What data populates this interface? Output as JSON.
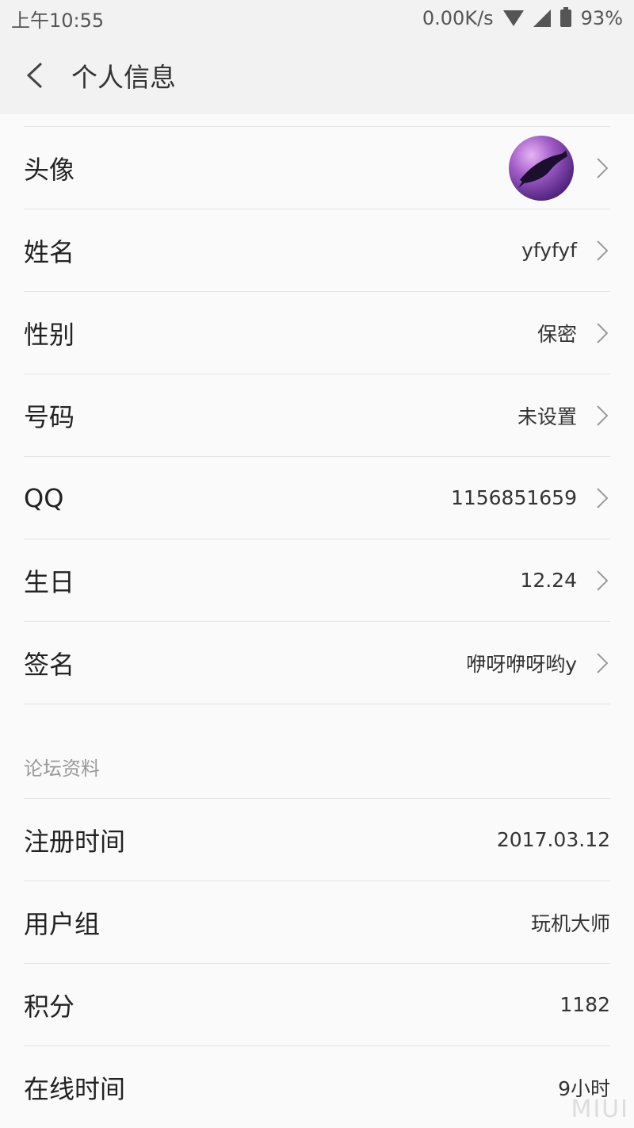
{
  "status_bar": {
    "time": "上午10:55",
    "network_speed": "0.00K/s",
    "battery": "93%"
  },
  "header": {
    "title": "个人信息"
  },
  "profile_rows": [
    {
      "label": "头像",
      "value": ""
    },
    {
      "label": "姓名",
      "value": "yfyfyf"
    },
    {
      "label": "性别",
      "value": "保密"
    },
    {
      "label": "号码",
      "value": "未设置"
    },
    {
      "label": "QQ",
      "value": "1156851659"
    },
    {
      "label": "生日",
      "value": "12.24"
    },
    {
      "label": "签名",
      "value": "咿呀咿呀哟y"
    }
  ],
  "forum": {
    "section_title": "论坛资料",
    "rows": [
      {
        "label": "注册时间",
        "value": "2017.03.12"
      },
      {
        "label": "用户组",
        "value": "玩机大师"
      },
      {
        "label": "积分",
        "value": "1182"
      },
      {
        "label": "在线时间",
        "value": "9小时"
      }
    ]
  },
  "watermark": "MIUI"
}
